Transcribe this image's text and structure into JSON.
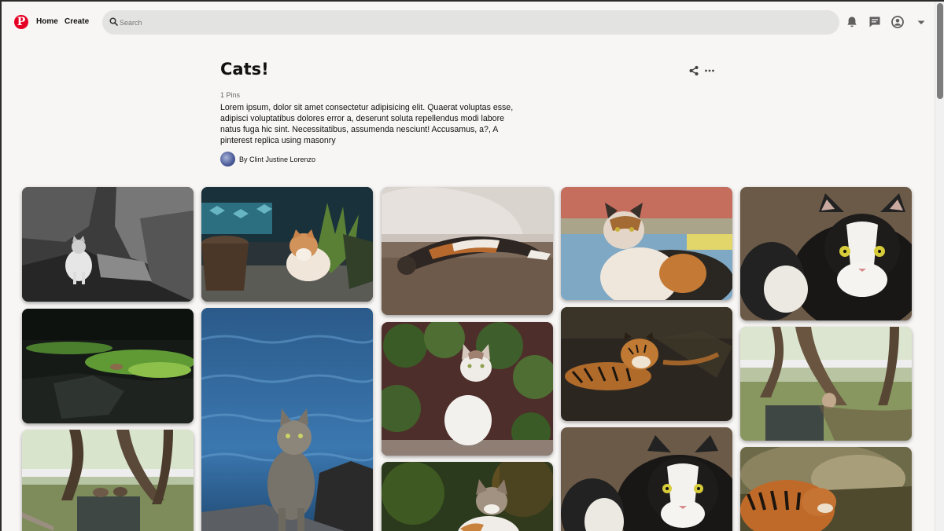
{
  "header": {
    "logo_letter": "P",
    "nav": {
      "home": "Home",
      "create": "Create"
    },
    "search": {
      "placeholder": "Search",
      "value": ""
    }
  },
  "board": {
    "title": "Cats!",
    "pin_count": "1 Pins",
    "description": "Lorem ipsum, dolor sit amet consectetur adipisicing elit. Quaerat voluptas esse, adipisci voluptatibus dolores error a, deserunt soluta repellendus modi labore natus fuga hic sint. Necessitatibus, assumenda nesciunt! Accusamus, a?, A pinterest replica using masonry",
    "author": "By Clint Justine Lorenzo"
  },
  "icons": {
    "logo": "pinterest-logo",
    "search": "search-icon",
    "notifications": "bell-icon",
    "messages": "chat-icon",
    "account": "user-icon",
    "menu": "chevron-down-icon",
    "share": "share-icon",
    "more": "ellipsis-icon"
  },
  "colors": {
    "brand": "#e60023",
    "page_background": "#f8f6f4",
    "search_background": "#e3e3e1"
  },
  "pins": [
    {
      "subject": "gray and white cat on rocks (black and white photo)"
    },
    {
      "subject": "orange and white cat beside a potted plant"
    },
    {
      "subject": "calico cat lying on the ground"
    },
    {
      "subject": "calico cat with yellow eyes"
    },
    {
      "subject": "black and white cat with yellow eyes"
    },
    {
      "subject": "cat on dark rocks with green plants"
    },
    {
      "subject": "gray tabby cat by the sea"
    },
    {
      "subject": "white cat sitting among leaves"
    },
    {
      "subject": "tiger lying in dark undergrowth"
    },
    {
      "subject": "cat on a bench in a park with trees"
    },
    {
      "subject": "cats on a ledge in a park"
    },
    {
      "subject": "tabby and white cat in the woods"
    },
    {
      "subject": "black and white cat close-up"
    },
    {
      "subject": "tiger drinking near a boulder"
    }
  ]
}
